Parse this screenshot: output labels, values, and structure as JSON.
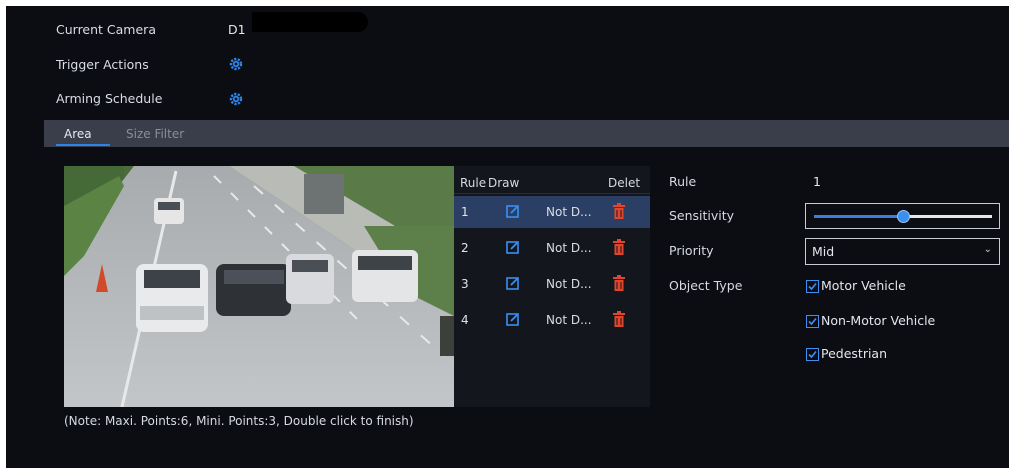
{
  "camera": {
    "label": "Current Camera",
    "value": "D1"
  },
  "trigger_actions": {
    "label": "Trigger Actions",
    "icon": "gear-icon"
  },
  "arming_schedule": {
    "label": "Arming Schedule",
    "icon": "gear-icon"
  },
  "tabs": [
    {
      "label": "Area",
      "active": true
    },
    {
      "label": "Size Filter",
      "active": false
    }
  ],
  "rule_table": {
    "headers": {
      "rule": "Rule",
      "draw": "Draw",
      "delete": "Delet"
    },
    "rows": [
      {
        "num": "1",
        "status": "Not D...",
        "selected": true
      },
      {
        "num": "2",
        "status": "Not D...",
        "selected": false
      },
      {
        "num": "3",
        "status": "Not D...",
        "selected": false
      },
      {
        "num": "4",
        "status": "Not D...",
        "selected": false
      }
    ]
  },
  "properties": {
    "rule_label": "Rule",
    "rule_value": "1",
    "sensitivity_label": "Sensitivity",
    "sensitivity_level": 0.5,
    "priority_label": "Priority",
    "priority_value": "Mid",
    "object_type_label": "Object Type",
    "object_types": [
      {
        "label": "Motor Vehicle",
        "checked": true
      },
      {
        "label": "Non-Motor Vehicle",
        "checked": true
      },
      {
        "label": "Pedestrian",
        "checked": true
      }
    ]
  },
  "note": "(Note: Maxi. Points:6, Mini. Points:3, Double click to finish)",
  "colors": {
    "background": "#0c0d13",
    "accent": "#3b7ee0",
    "delete": "#e0452e",
    "selected_row": "#2a3f63"
  }
}
